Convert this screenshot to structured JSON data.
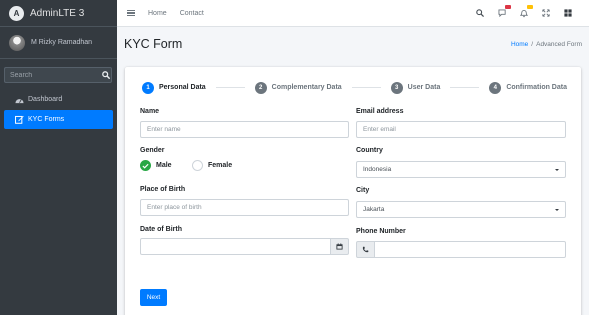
{
  "brand": {
    "name": "AdminLTE 3",
    "logo_letter": "A"
  },
  "user": {
    "name": "M Rizky Ramadhan"
  },
  "sidebar": {
    "search_placeholder": "Search",
    "items": [
      {
        "label": "Dashboard",
        "icon": "tachometer-icon",
        "active": false
      },
      {
        "label": "KYC Forms",
        "icon": "edit-icon",
        "active": true
      }
    ]
  },
  "topbar": {
    "links": [
      "Home",
      "Contact"
    ],
    "icons": [
      "search-icon",
      "comments-icon",
      "bell-icon",
      "expand-icon",
      "grid-icon"
    ],
    "badge_colors": {
      "messages": "#dc3545",
      "notifications": "#ffc107"
    }
  },
  "header": {
    "title": "KYC Form",
    "breadcrumb": {
      "home": "Home",
      "separator": "/",
      "current": "Advanced Form"
    }
  },
  "stepper": {
    "steps": [
      {
        "number": "1",
        "label": "Personal Data",
        "active": true
      },
      {
        "number": "2",
        "label": "Complementary Data",
        "active": false
      },
      {
        "number": "3",
        "label": "User Data",
        "active": false
      },
      {
        "number": "4",
        "label": "Confirmation Data",
        "active": false
      }
    ]
  },
  "form": {
    "name": {
      "label": "Name",
      "placeholder": "Enter name",
      "value": ""
    },
    "gender": {
      "label": "Gender",
      "options": [
        "Male",
        "Female"
      ],
      "selected": "Male"
    },
    "place_of_birth": {
      "label": "Place of Birth",
      "placeholder": "Enter place of birth",
      "value": ""
    },
    "date_of_birth": {
      "label": "Date of Birth",
      "value": ""
    },
    "email": {
      "label": "Email address",
      "placeholder": "Enter email",
      "value": ""
    },
    "country": {
      "label": "Country",
      "value": "Indonesia"
    },
    "city": {
      "label": "City",
      "value": "Jakarta"
    },
    "phone": {
      "label": "Phone Number",
      "value": ""
    },
    "next_label": "Next"
  },
  "colors": {
    "primary": "#007bff",
    "success": "#28a745",
    "sidebar_bg": "#343a40"
  }
}
